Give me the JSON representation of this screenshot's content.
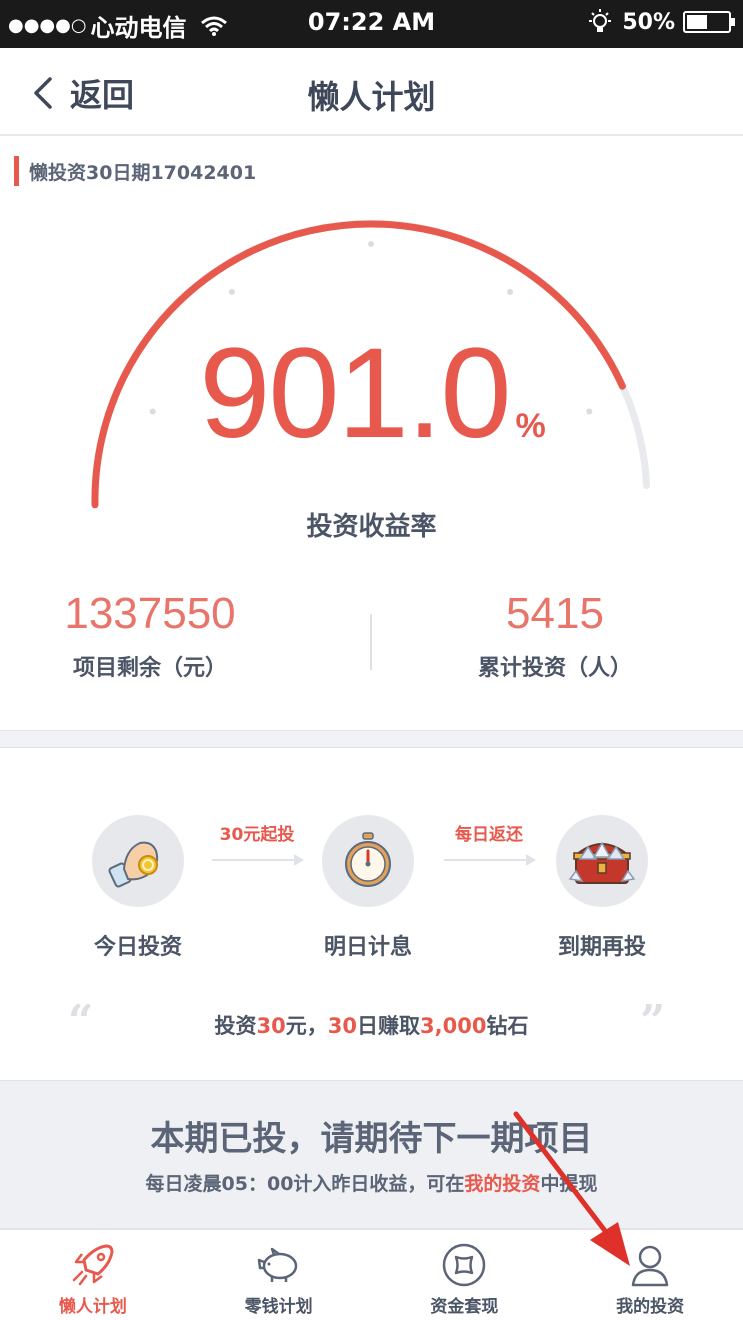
{
  "status_bar": {
    "carrier": "心动电信",
    "time": "07:22 AM",
    "battery_text": "50%",
    "battery_level": 0.5
  },
  "nav": {
    "back_label": "返回",
    "title": "懒人计划"
  },
  "product": {
    "tag": "懒投资30日期17042401"
  },
  "gauge": {
    "rate_value": "901.0",
    "rate_unit": "%",
    "rate_label": "投资收益率",
    "progress": 0.88
  },
  "stats": {
    "remaining_value": "1337550",
    "remaining_label": "项目剩余（元）",
    "investors_value": "5415",
    "investors_label": "累计投资（人）"
  },
  "steps": {
    "step1_label": "今日投资",
    "arrow1_text": "30元起投",
    "step2_label": "明日计息",
    "arrow2_text": "每日返还",
    "step3_label": "到期再投"
  },
  "promo": {
    "p1": "投资",
    "p2": "30",
    "p3": "元，",
    "p4": "30",
    "p5": "日赚取",
    "p6": "3,000",
    "p7": "钻石"
  },
  "notice": {
    "title": "本期已投，请期待下一期项目",
    "sub_prefix": "每日凌晨05：00计入昨日收益，可在",
    "sub_link": "我的投资",
    "sub_suffix": "中提现"
  },
  "tabs": [
    {
      "label": "懒人计划",
      "icon": "rocket-icon"
    },
    {
      "label": "零钱计划",
      "icon": "piggy-bank-icon"
    },
    {
      "label": "资金套现",
      "icon": "coin-icon"
    },
    {
      "label": "我的投资",
      "icon": "user-icon"
    }
  ],
  "colors": {
    "accent": "#e8594d",
    "text": "#4b5566",
    "annotation_arrow": "#e0302a"
  }
}
